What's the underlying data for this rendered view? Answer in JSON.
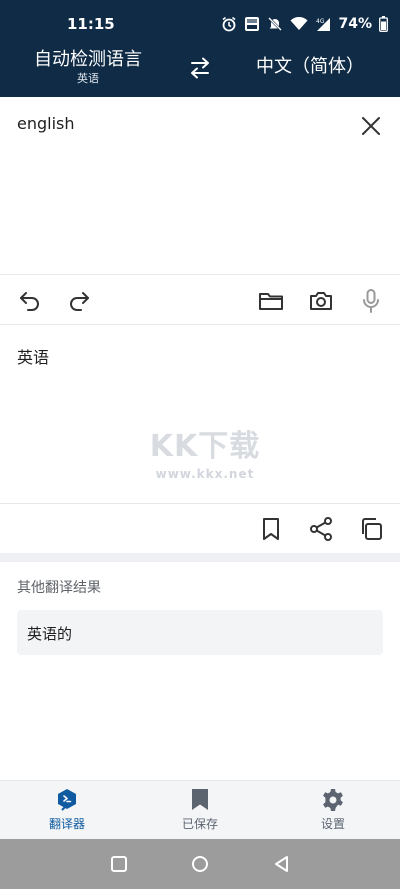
{
  "status_bar": {
    "time": "11:15",
    "battery": "74%",
    "icons": [
      "alarm-icon",
      "volte-icon",
      "mute-icon",
      "wifi-icon",
      "signal-4g-icon",
      "battery-icon"
    ]
  },
  "language_bar": {
    "source_language": "自动检测语言",
    "detected_language": "英语",
    "target_language": "中文（简体）",
    "swap_icon": "swap-arrows-icon"
  },
  "input": {
    "text": "english",
    "clear_icon": "close-icon"
  },
  "input_toolbar": {
    "icons": [
      "undo-icon",
      "redo-icon",
      "folder-icon",
      "camera-icon",
      "microphone-icon"
    ]
  },
  "output": {
    "text": "英语",
    "watermark": "KK下载",
    "watermark_url": "www.kkx.net"
  },
  "output_toolbar": {
    "icons": [
      "bookmark-icon",
      "share-icon",
      "copy-icon"
    ]
  },
  "other_results": {
    "title": "其他翻译结果",
    "items": [
      "英语的"
    ]
  },
  "bottom_nav": {
    "items": [
      {
        "label": "翻译器",
        "icon": "translator-icon",
        "active": true
      },
      {
        "label": "已保存",
        "icon": "bookmark-icon",
        "active": false
      },
      {
        "label": "设置",
        "icon": "gear-icon",
        "active": false
      }
    ]
  },
  "colors": {
    "header_bg": "#0f2b46",
    "accent": "#0f5aa0",
    "nav_inactive": "#5c6470"
  }
}
